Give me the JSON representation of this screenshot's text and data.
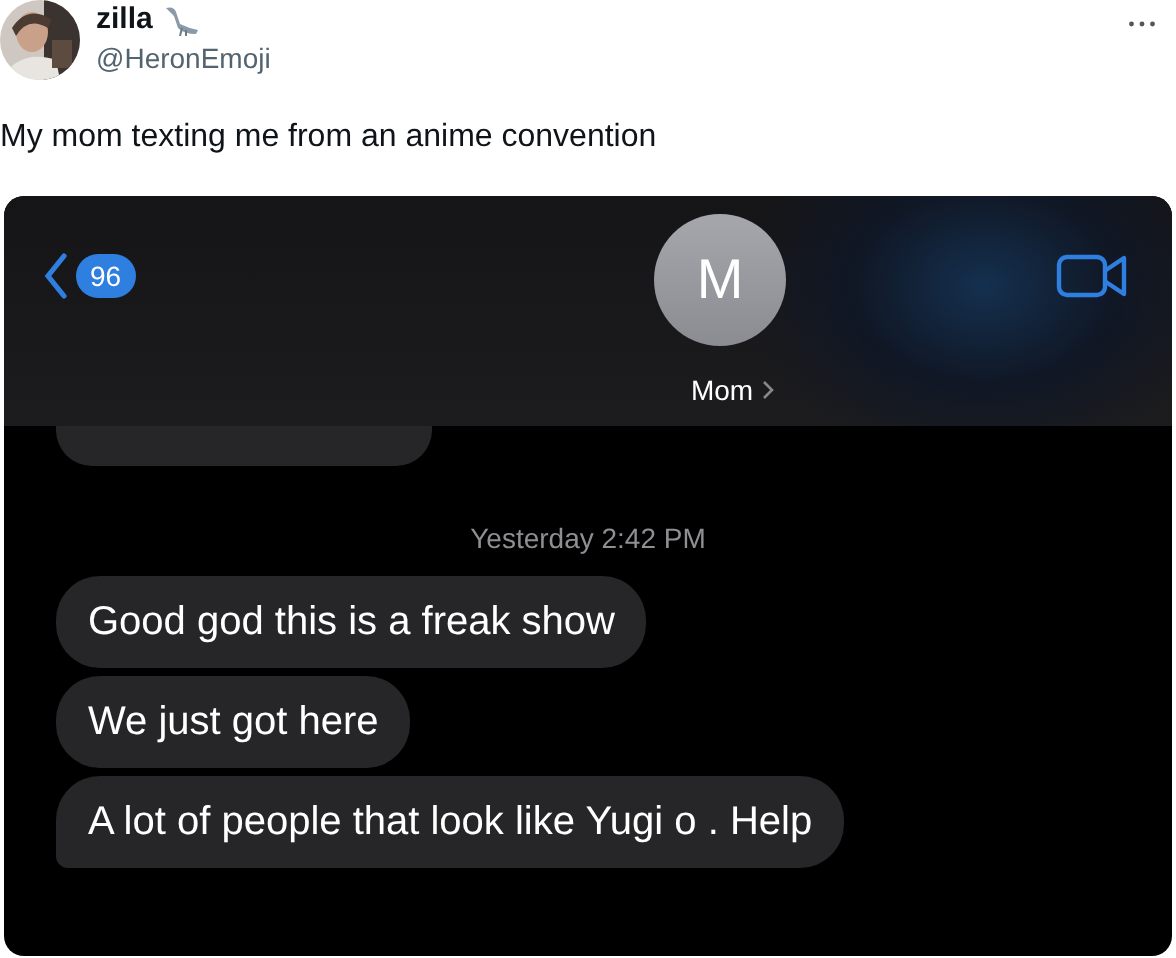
{
  "tweet": {
    "author_name": "zilla",
    "handle": "@HeronEmoji",
    "text": "My mom texting me from an anime convention"
  },
  "conversation": {
    "back_count": "96",
    "contact_initial": "M",
    "contact_name": "Mom",
    "timestamp": "Yesterday 2:42 PM",
    "messages": [
      {
        "text": "Good god this is a freak show",
        "tail": false
      },
      {
        "text": "We just got here",
        "tail": false
      },
      {
        "text": "A lot of people that look like Yugi o . Help",
        "tail": true
      }
    ]
  }
}
